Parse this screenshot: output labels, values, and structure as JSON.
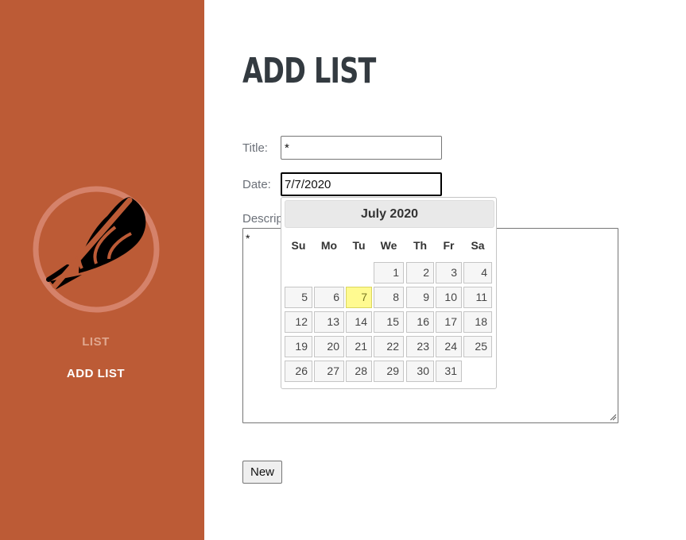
{
  "sidebar": {
    "nav": [
      {
        "label": "LIST"
      },
      {
        "label": "ADD LIST"
      }
    ],
    "colors": {
      "background": "#bc5b36",
      "active": "#ffffff",
      "inactive": "#e0a78e"
    }
  },
  "page": {
    "title": "ADD LIST"
  },
  "form": {
    "title_label": "Title:",
    "title_value": "*",
    "date_label": "Date:",
    "date_value": "7/7/2020",
    "description_label": "Description:",
    "description_visible": "Descrip",
    "description_value": "*",
    "submit_label": "New"
  },
  "datepicker": {
    "month_label": "July 2020",
    "weekdays": [
      "Su",
      "Mo",
      "Tu",
      "We",
      "Th",
      "Fr",
      "Sa"
    ],
    "first_weekday_index": 3,
    "days_in_month": 31,
    "selected_day": 7,
    "highlight_color": "#fffa90"
  }
}
